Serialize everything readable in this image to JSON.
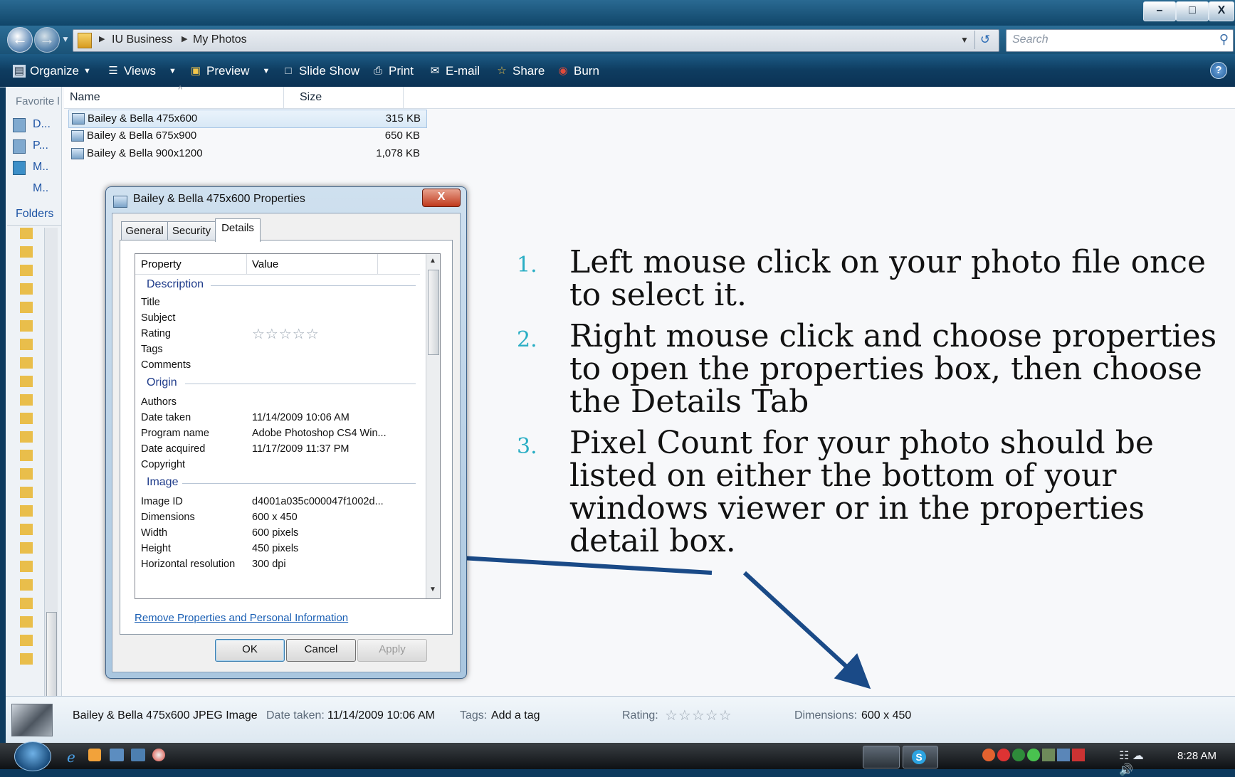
{
  "window": {
    "minimize_label": "–",
    "maximize_label": "□",
    "close_label": "X"
  },
  "address": {
    "breadcrumb": [
      "IU Business",
      "My Photos"
    ],
    "search_placeholder": "Search"
  },
  "toolbar": {
    "items": [
      {
        "label": "Organize",
        "icon": "organize-icon"
      },
      {
        "label": "Views",
        "icon": "views-icon"
      },
      {
        "label": "Preview",
        "icon": "preview-icon"
      },
      {
        "label": "Slide Show",
        "icon": "slideshow-icon"
      },
      {
        "label": "Print",
        "icon": "print-icon"
      },
      {
        "label": "E-mail",
        "icon": "email-icon"
      },
      {
        "label": "Share",
        "icon": "share-icon"
      },
      {
        "label": "Burn",
        "icon": "burn-icon"
      }
    ],
    "help_label": "?"
  },
  "navpane": {
    "favorites_label": "Favorite l",
    "links": [
      "D...",
      "P...",
      "M..",
      "M.."
    ],
    "folders_label": "Folders"
  },
  "filelist": {
    "columns": [
      "Name",
      "Size"
    ],
    "files": [
      {
        "name": "Bailey & Bella 475x600",
        "size": "315 KB"
      },
      {
        "name": "Bailey & Bella 675x900",
        "size": "650 KB"
      },
      {
        "name": "Bailey & Bella 900x1200",
        "size": "1,078 KB"
      }
    ]
  },
  "dialog": {
    "title": "Bailey & Bella 475x600 Properties",
    "close_label": "X",
    "tabs": [
      "General",
      "Security",
      "Details"
    ],
    "active_tab": "Details",
    "columns": [
      "Property",
      "Value"
    ],
    "groups": {
      "description": "Description",
      "origin": "Origin",
      "image": "Image"
    },
    "description_rows": [
      {
        "label": "Title",
        "value": ""
      },
      {
        "label": "Subject",
        "value": ""
      },
      {
        "label": "Rating",
        "value": "☆☆☆☆☆"
      },
      {
        "label": "Tags",
        "value": ""
      },
      {
        "label": "Comments",
        "value": ""
      }
    ],
    "origin_rows": [
      {
        "label": "Authors",
        "value": ""
      },
      {
        "label": "Date taken",
        "value": "11/14/2009 10:06 AM"
      },
      {
        "label": "Program name",
        "value": "Adobe Photoshop CS4 Win..."
      },
      {
        "label": "Date acquired",
        "value": "11/17/2009 11:37 PM"
      },
      {
        "label": "Copyright",
        "value": ""
      }
    ],
    "image_rows": [
      {
        "label": "Image ID",
        "value": "d4001a035c000047f1002d..."
      },
      {
        "label": "Dimensions",
        "value": "600 x 450"
      },
      {
        "label": "Width",
        "value": "600 pixels"
      },
      {
        "label": "Height",
        "value": "450 pixels"
      },
      {
        "label": "Horizontal resolution",
        "value": "300 dpi"
      }
    ],
    "remove_link": "Remove Properties and Personal Information",
    "ok_label": "OK",
    "cancel_label": "Cancel",
    "apply_label": "Apply"
  },
  "instructions": [
    {
      "num": "1.",
      "lines": [
        "Left mouse click on your photo file once",
        "to select it."
      ]
    },
    {
      "num": "2.",
      "lines": [
        "Right mouse click and choose properties",
        "to open the properties box, then choose",
        "the Details Tab"
      ]
    },
    {
      "num": "3.",
      "lines": [
        "Pixel Count for your photo should be",
        "listed on either the bottom of your",
        "windows viewer or in the properties",
        "detail box."
      ]
    }
  ],
  "detailsbar": {
    "file_type": "Bailey & Bella 475x600 JPEG Image",
    "date_taken_label": "Date taken:",
    "date_taken_value": "11/14/2009 10:06 AM",
    "tags_label": "Tags:",
    "tags_value": "Add a tag",
    "rating_label": "Rating:",
    "rating_value": "☆☆☆☆☆",
    "dimensions_label": "Dimensions:",
    "dimensions_value": "600 x 450"
  },
  "taskbar": {
    "clock": "8:28 AM"
  },
  "colors": {
    "accent_blue": "#1c4f8a",
    "step_number": "#2aaec4",
    "arrow": "#1a4a87"
  }
}
